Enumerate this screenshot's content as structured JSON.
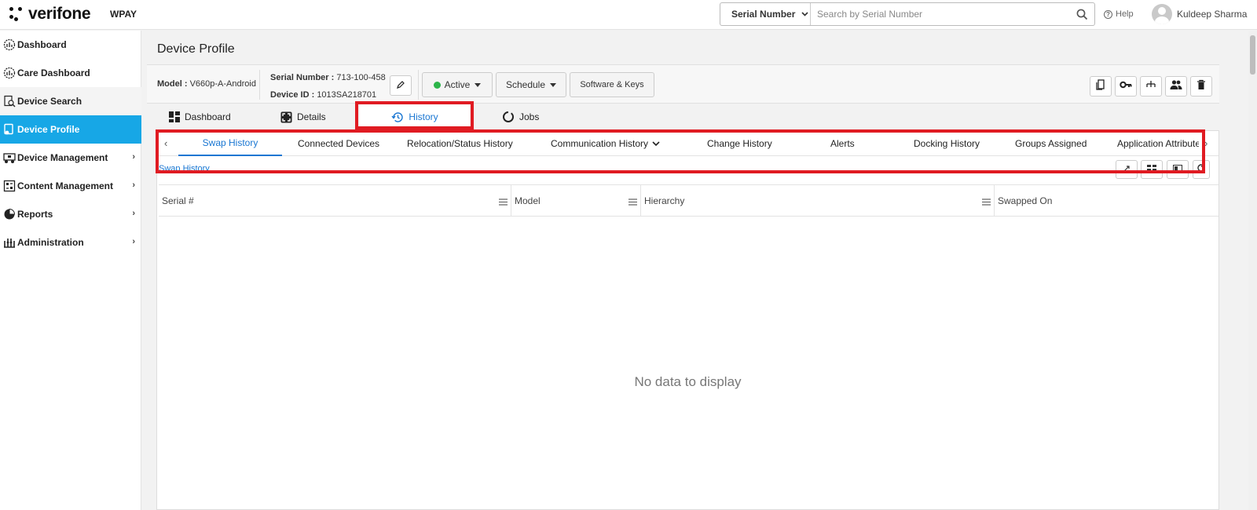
{
  "header": {
    "brand": "verifone",
    "org": "WPAY",
    "search_type": "Serial Number",
    "search_placeholder": "Search by Serial Number",
    "help_label": "Help",
    "user_name": "Kuldeep Sharma"
  },
  "sidebar": {
    "items": [
      {
        "label": "Dashboard",
        "icon": "dashboard-gauge-icon"
      },
      {
        "label": "Care Dashboard",
        "icon": "care-gauge-icon"
      },
      {
        "label": "Device Search",
        "icon": "device-search-icon"
      },
      {
        "label": "Device Profile",
        "icon": "device-profile-icon",
        "active": true
      },
      {
        "label": "Device Management",
        "icon": "device-management-icon",
        "arrow": "›"
      },
      {
        "label": "Content Management",
        "icon": "content-management-icon",
        "arrow": "›"
      },
      {
        "label": "Reports",
        "icon": "pie-chart-icon",
        "arrow": "›"
      },
      {
        "label": "Administration",
        "icon": "administration-icon",
        "arrow": "›"
      }
    ]
  },
  "page": {
    "title": "Device Profile",
    "model_label": "Model : ",
    "model_value": "V660p-A-Android",
    "serial_label": "Serial Number : ",
    "serial_value": "713-100-458",
    "device_id_label": "Device ID : ",
    "device_id_value": "1013SA218701",
    "status_label": "Active",
    "schedule_label": "Schedule",
    "software_keys_label": "Software & Keys"
  },
  "tabs": [
    {
      "label": "Dashboard",
      "icon": "grid-icon"
    },
    {
      "label": "Details",
      "icon": "expand-icon"
    },
    {
      "label": "History",
      "icon": "history-icon",
      "active": true
    },
    {
      "label": "Jobs",
      "icon": "jobs-circle-icon"
    }
  ],
  "subtabs": [
    {
      "label": "Swap History",
      "active": true
    },
    {
      "label": "Connected Devices"
    },
    {
      "label": "Relocation/Status History"
    },
    {
      "label": "Communication History",
      "dropdown": true
    },
    {
      "label": "Change History"
    },
    {
      "label": "Alerts"
    },
    {
      "label": "Docking History"
    },
    {
      "label": "Groups Assigned"
    },
    {
      "label": "Application Attribute"
    }
  ],
  "content": {
    "section_label": "Swap History",
    "columns": [
      "Serial #",
      "Model",
      "Hierarchy",
      "Swapped On"
    ],
    "empty_text": "No data to display"
  },
  "colors": {
    "accent": "#17a7e6",
    "link": "#1976d2",
    "highlight": "#e01b22",
    "status_green": "#2db54a"
  }
}
